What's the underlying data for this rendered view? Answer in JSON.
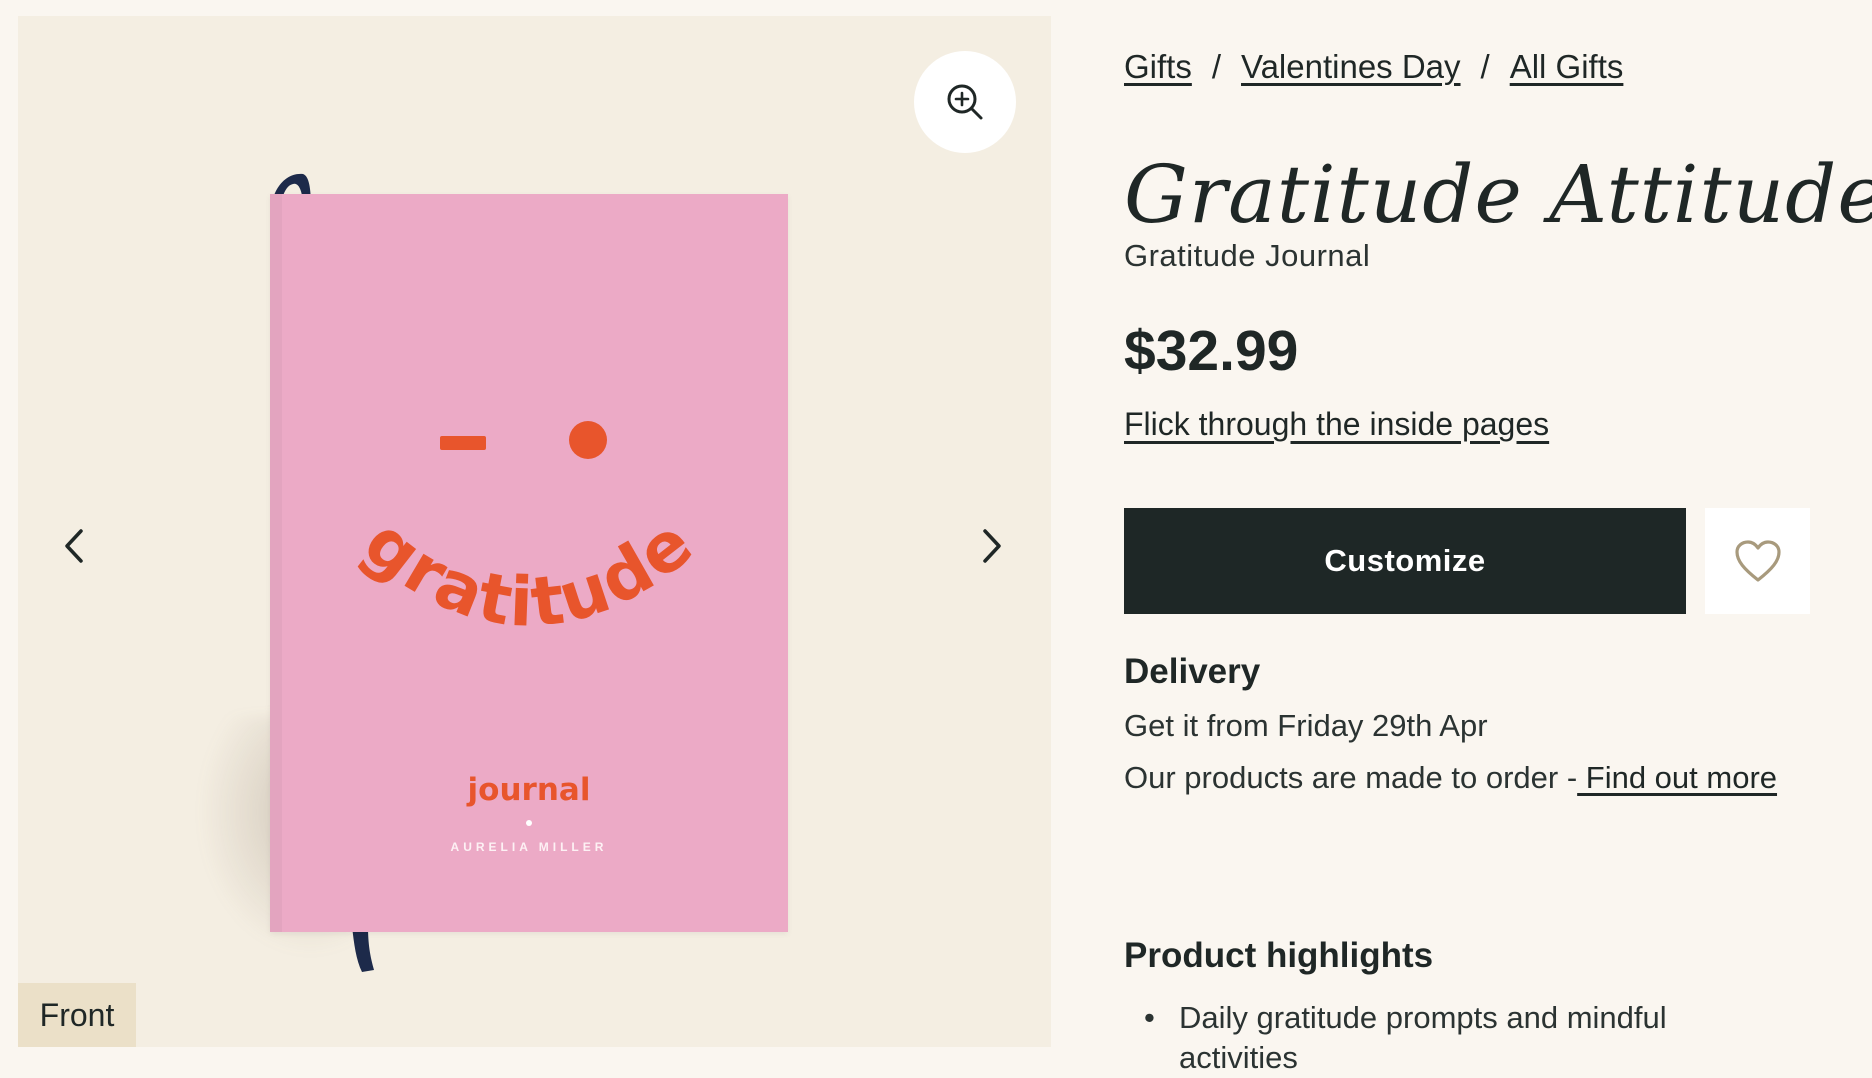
{
  "gallery": {
    "zoom_icon": "zoom-in-icon",
    "prev_icon": "chevron-left-icon",
    "next_icon": "chevron-right-icon",
    "view_label": "Front",
    "cover": {
      "arc_text": "gratitude",
      "title": "journal",
      "author": "AURELIA MILLER",
      "cover_color": "#ecaac6",
      "accent_color": "#e8552c",
      "ribbon_color": "#1d2a4a"
    }
  },
  "breadcrumb": {
    "items": [
      "Gifts",
      "Valentines Day",
      "All Gifts"
    ],
    "separator": "/"
  },
  "product": {
    "title": "Gratitude Attitude",
    "subtitle": "Gratitude Journal",
    "price": "$32.99",
    "flick_link": "Flick through the inside pages",
    "customize_label": "Customize",
    "wishlist_icon": "heart-icon"
  },
  "delivery": {
    "heading": "Delivery",
    "date_text": "Get it from Friday 29th Apr",
    "note_text": "Our products are made to order -",
    "note_link": " Find out more"
  },
  "highlights": {
    "heading": "Product highlights",
    "bullet": "•",
    "items": [
      "Daily gratitude prompts and mindful activities"
    ]
  },
  "colors": {
    "page_bg": "#faf6f0",
    "gallery_bg": "#f4eee2",
    "button_dark": "#1e2726",
    "heart_stroke": "#a89a7d",
    "label_bg": "#ebe0c8"
  }
}
